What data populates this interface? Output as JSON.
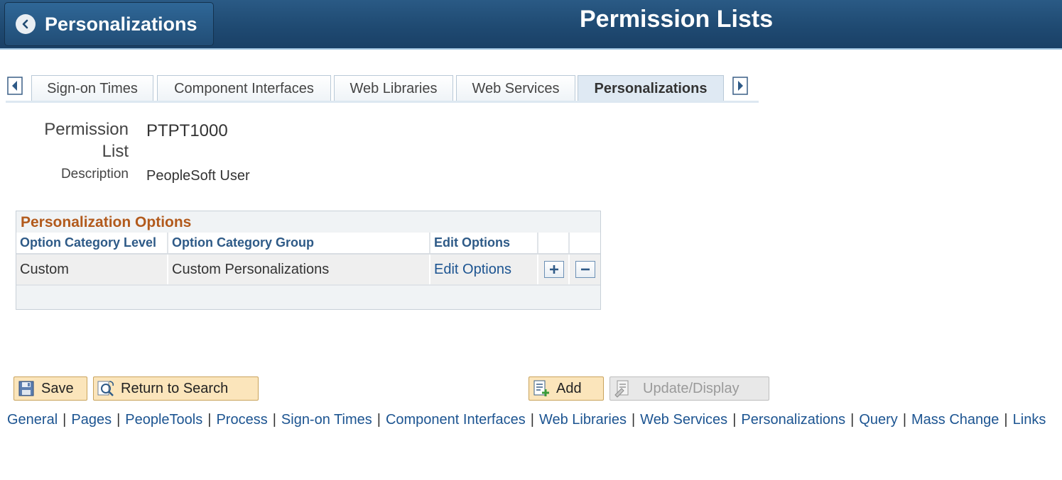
{
  "header": {
    "back_label": "Personalizations",
    "title": "Permission Lists"
  },
  "tabs": [
    {
      "label": "Sign-on Times",
      "active": false
    },
    {
      "label": "Component Interfaces",
      "active": false
    },
    {
      "label": "Web Libraries",
      "active": false
    },
    {
      "label": "Web Services",
      "active": false
    },
    {
      "label": "Personalizations",
      "active": true
    }
  ],
  "form": {
    "permission_list_label_line1": "Permission",
    "permission_list_label_line2": "List",
    "permission_list_value": "PTPT1000",
    "description_label": "Description",
    "description_value": "PeopleSoft User"
  },
  "grid": {
    "title": "Personalization Options",
    "columns": [
      "Option Category Level",
      "Option Category Group",
      "Edit Options"
    ],
    "rows": [
      {
        "level": "Custom",
        "group": "Custom Personalizations",
        "edit": "Edit Options"
      }
    ]
  },
  "buttons": {
    "save": "Save",
    "return_to_search": "Return to Search",
    "add": "Add",
    "update_display": "Update/Display"
  },
  "footer_links": [
    "General",
    "Pages",
    "PeopleTools",
    "Process",
    "Sign-on Times",
    "Component Interfaces",
    "Web Libraries",
    "Web Services",
    "Personalizations",
    "Query",
    "Mass Change",
    "Links"
  ],
  "colors": {
    "banner": "#1f4a72",
    "link": "#1c5491",
    "grid_title": "#b25a1c",
    "button": "#fbe5bb"
  }
}
